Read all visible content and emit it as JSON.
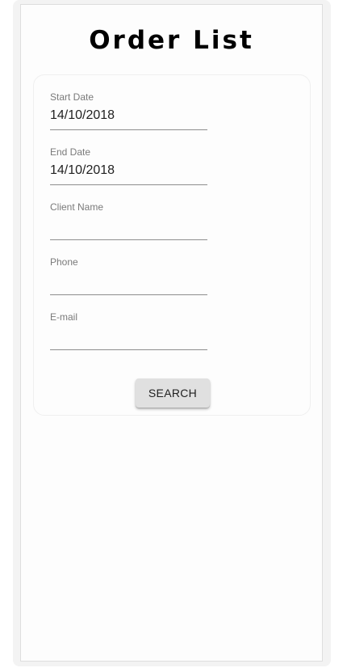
{
  "page": {
    "title": "Order List"
  },
  "form": {
    "fields": [
      {
        "label": "Start Date",
        "value": "14/10/2018"
      },
      {
        "label": "End Date",
        "value": "14/10/2018"
      },
      {
        "label": "Client Name",
        "value": ""
      },
      {
        "label": "Phone",
        "value": ""
      },
      {
        "label": "E-mail",
        "value": ""
      }
    ],
    "search_label": "SEARCH"
  }
}
